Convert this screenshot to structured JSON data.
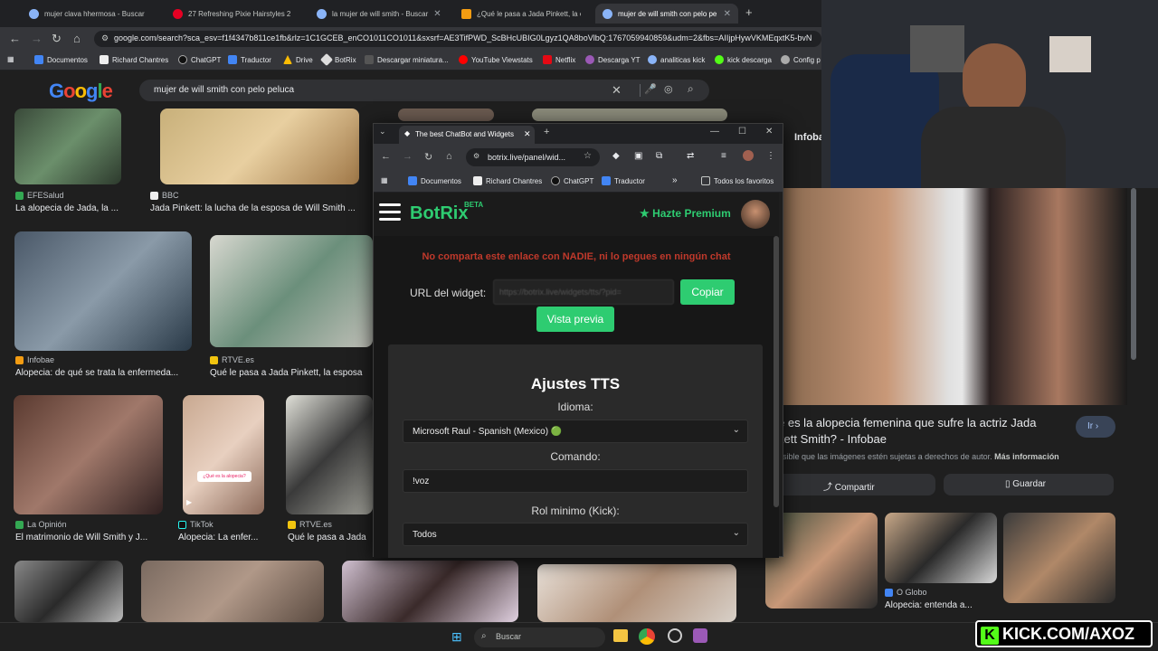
{
  "browser": {
    "tabs": [
      {
        "label": "mujer clava hhermosa - Buscar"
      },
      {
        "label": "27 Refreshing Pixie Hairstyles 2"
      },
      {
        "label": "la mujer de will smith - Buscar"
      },
      {
        "label": "¿Qué le pasa a Jada Pinkett, la e"
      },
      {
        "label": "mujer de will smith con pelo pe"
      }
    ],
    "new_tab": "+",
    "url": "google.com/search?sca_esv=f1f4347b811ce1fb&rlz=1C1GCEB_enCO1011CO1011&sxsrf=AE3TifPWD_ScBHcUBIG0Lgyz1QA8boVlbQ:1767059940859&udm=2&fbs=AIIjpHywVKMEqxtK5-bvN",
    "bookmarks": [
      "Documentos",
      "Richard Chantres",
      "ChatGPT",
      "Traductor",
      "Drive",
      "BotRix",
      "Descargar miniatura...",
      "YouTube Viewstats",
      "Netflix",
      "Descarga YT",
      "analiticas kick",
      "kick descarga",
      "Config p"
    ]
  },
  "google": {
    "logo": "Google",
    "query": "mujer de will smith con pelo peluca",
    "results": [
      {
        "source": "EFESalud",
        "title": "La alopecia de Jada, la ..."
      },
      {
        "source": "BBC",
        "title": "Jada Pinkett: la lucha de la esposa de Will Smith ..."
      },
      {
        "source": "Infobae",
        "title": "Alopecia: de qué se trata la enfermeda..."
      },
      {
        "source": "RTVE.es",
        "title": "Qué le pasa a Jada Pinkett, la esposa"
      },
      {
        "source": "La Opinión",
        "title": "El matrimonio de Will Smith y J..."
      },
      {
        "source": "TikTok",
        "title": "Alopecia: La enfer..."
      },
      {
        "source": "RTVE.es",
        "title": "Qué le pasa a Jada"
      }
    ],
    "tiktok_overlay": "¿Qué es la alopecia?"
  },
  "popup": {
    "tab_title": "The best ChatBot and Widgets",
    "url": "botrix.live/panel/wid...",
    "bookmarks": [
      "Documentos",
      "Richard Chantres",
      "ChatGPT",
      "Traductor"
    ],
    "all_bookmarks": "Todos los favoritos",
    "brand": "BotRix",
    "beta": "BETA",
    "premium": "Hazte Premium",
    "warning": "No comparta este enlace con NADIE, ni lo pegues en ningún chat",
    "widget_label": "URL del widget:",
    "widget_url": "https://botrix.live/widgets/tts/?pid=",
    "copy": "Copiar",
    "preview": "Vista previa",
    "tts_title": "Ajustes TTS",
    "language_label": "Idioma:",
    "language_value": "Microsoft Raul - Spanish (Mexico) 🟢",
    "command_label": "Comando:",
    "command_value": "!voz",
    "role_label": "Rol minimo (Kick):",
    "role_value": "Todos"
  },
  "right_panel": {
    "site": "Infobae",
    "headline_line1": "é es la alopecia femenina que sufre la actriz Jada",
    "headline_line2": "kett Smith? - Infobae",
    "go": "Ir",
    "copyright": "osible que las imágenes estén sujetas a derechos de autor.",
    "more_info": "Más información",
    "share": "Compartir",
    "save": "Guardar",
    "related_source": "O Globo",
    "related_title": "Alopecia: entenda a..."
  },
  "taskbar": {
    "search": "Buscar"
  },
  "overlay": {
    "kick": "KICK.COM/AXOZ"
  },
  "colors": {
    "accent_green": "#2ecc71",
    "warning_red": "#c0392b",
    "kick_green": "#53fc18"
  }
}
